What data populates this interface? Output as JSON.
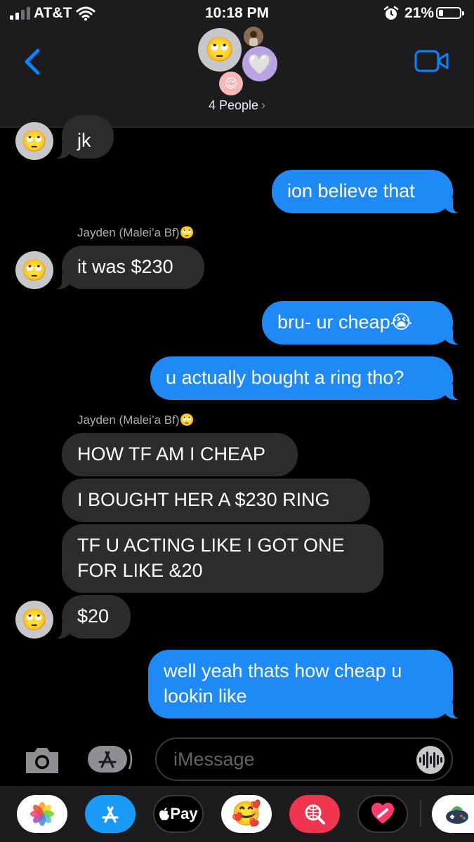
{
  "status_bar": {
    "carrier": "AT&T",
    "time": "10:18 PM",
    "battery_percent": "21%",
    "battery_level": 0.21,
    "signal_bars_filled": 2,
    "signal_bars_total": 4
  },
  "header": {
    "participants_label": "4 People",
    "participants_chevron": "›",
    "main_avatar_emoji": "🙄",
    "second_avatar_emoji": "🤍",
    "third_avatar_emoji": "😌"
  },
  "messages": [
    {
      "direction": "in",
      "text": "jk",
      "avatar_emoji": "🙄"
    },
    {
      "direction": "out",
      "text": "ion believe that"
    },
    {
      "direction": "in",
      "sender": "Jayden (Malei’a Bf)🙄",
      "text": "it was $230",
      "avatar_emoji": "🙄"
    },
    {
      "direction": "out",
      "text": "bru- ur cheap😭"
    },
    {
      "direction": "out",
      "text": "u actually bought a ring tho?"
    },
    {
      "direction": "in",
      "sender": "Jayden (Malei’a Bf)🙄",
      "text": "HOW TF AM I CHEAP"
    },
    {
      "direction": "in",
      "text": "I BOUGHT HER A $230 RING"
    },
    {
      "direction": "in",
      "text": "TF U ACTING LIKE I GOT ONE FOR LIKE &20"
    },
    {
      "direction": "in",
      "text": "$20",
      "avatar_emoji": "🙄"
    },
    {
      "direction": "out",
      "text": "well yeah thats how cheap u lookin like"
    }
  ],
  "composer": {
    "placeholder": "iMessage",
    "camera_icon": "camera-icon",
    "apps_icon": "app-store-icon",
    "audio_icon": "waveform-icon"
  },
  "app_drawer": [
    {
      "name": "photos-app-icon"
    },
    {
      "name": "app-store-app-icon"
    },
    {
      "name": "apple-pay-app-icon",
      "label": "Pay"
    },
    {
      "name": "memoji-app-icon",
      "emoji": "🥰"
    },
    {
      "name": "web-search-app-icon"
    },
    {
      "name": "digital-touch-app-icon"
    },
    {
      "name": "game-pigeon-app-icon"
    }
  ],
  "colors": {
    "outgoing_bubble": "#1f8af6",
    "incoming_bubble": "#2c2c2e",
    "accent": "#0a84ff"
  }
}
